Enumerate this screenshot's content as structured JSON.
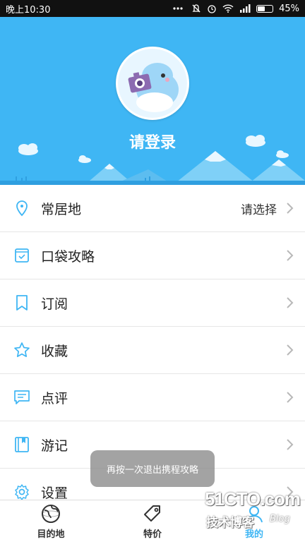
{
  "status_bar": {
    "time": "晚上10:30",
    "battery": "45%",
    "battery_level": 0.45
  },
  "header": {
    "login_label": "请登录",
    "accent_color": "#3fb6f4"
  },
  "menu": [
    {
      "label": "常居地",
      "value": "请选择",
      "icon": "location-pin-icon"
    },
    {
      "label": "口袋攻略",
      "icon": "guide-book-icon"
    },
    {
      "label": "订阅",
      "icon": "bookmark-icon"
    },
    {
      "label": "收藏",
      "icon": "star-icon"
    },
    {
      "label": "点评",
      "icon": "comment-icon"
    },
    {
      "label": "游记",
      "icon": "travel-notes-icon"
    },
    {
      "label": "设置",
      "icon": "gear-icon"
    }
  ],
  "toast": "再按一次退出携程攻略",
  "tabs": [
    {
      "label": "目的地",
      "icon": "globe-icon",
      "active": false
    },
    {
      "label": "特价",
      "icon": "price-tag-icon",
      "active": false
    },
    {
      "label": "我的",
      "icon": "profile-icon",
      "active": true
    }
  ],
  "watermark": {
    "brand": "51CTO.com",
    "subtitle": "技术博客",
    "blog": "Blog"
  }
}
